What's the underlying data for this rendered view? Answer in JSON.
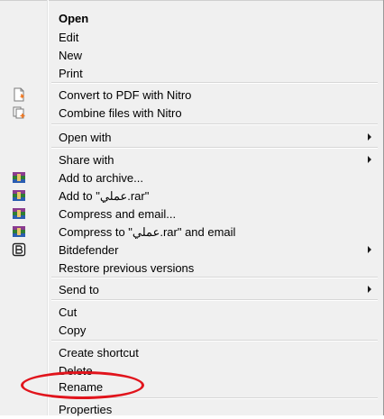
{
  "menu": {
    "items": [
      {
        "id": "open",
        "label": "Open",
        "bold": true
      },
      {
        "id": "edit",
        "label": "Edit"
      },
      {
        "id": "new",
        "label": "New"
      },
      {
        "id": "print",
        "label": "Print"
      },
      {
        "id": "convert-pdf",
        "label": "Convert to PDF with Nitro",
        "icon": "nitro-pdf-icon"
      },
      {
        "id": "combine-files",
        "label": "Combine files with Nitro",
        "icon": "nitro-combine-icon"
      },
      {
        "id": "open-with",
        "label": "Open with",
        "submenu": true
      },
      {
        "id": "share-with",
        "label": "Share with",
        "submenu": true
      },
      {
        "id": "add-archive",
        "label": "Add to archive...",
        "icon": "winrar-icon"
      },
      {
        "id": "add-to-rar",
        "label": "Add to \"عملي.rar\"",
        "icon": "winrar-icon"
      },
      {
        "id": "compress-email",
        "label": "Compress and email...",
        "icon": "winrar-icon"
      },
      {
        "id": "compress-to-rar-email",
        "label": "Compress to \"عملي.rar\" and email",
        "icon": "winrar-icon"
      },
      {
        "id": "bitdefender",
        "label": "Bitdefender",
        "submenu": true,
        "icon": "bitdefender-icon"
      },
      {
        "id": "restore-versions",
        "label": "Restore previous versions"
      },
      {
        "id": "send-to",
        "label": "Send to",
        "submenu": true
      },
      {
        "id": "cut",
        "label": "Cut"
      },
      {
        "id": "copy",
        "label": "Copy"
      },
      {
        "id": "create-shortcut",
        "label": "Create shortcut"
      },
      {
        "id": "delete",
        "label": "Delete"
      },
      {
        "id": "rename",
        "label": "Rename",
        "highlighted": true
      },
      {
        "id": "properties",
        "label": "Properties"
      }
    ],
    "annotation_color": "#e1141c"
  }
}
